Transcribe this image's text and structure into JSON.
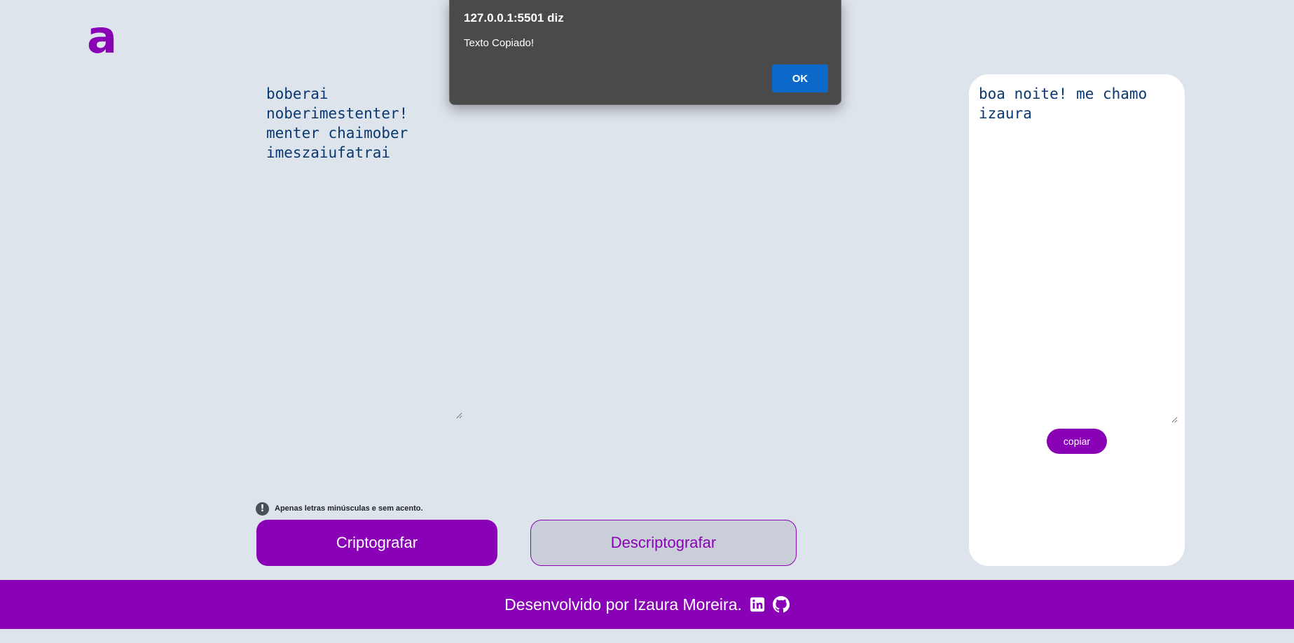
{
  "logo": {
    "text": "a"
  },
  "input": {
    "text": "boberai\nnoberimestenter!\nmenter chaimober\nimeszaiufatrai"
  },
  "hint": {
    "icon": "!",
    "text": "Apenas letras minúsculas e sem acento."
  },
  "buttons": {
    "encrypt": "Criptografar",
    "decrypt": "Descriptografar"
  },
  "output": {
    "text": "boa noite! me chamo\nizaura",
    "copy_label": "copiar"
  },
  "footer": {
    "text": "Desenvolvido por Izaura Moreira.",
    "icons": [
      "linkedin-icon",
      "github-icon"
    ]
  },
  "alert": {
    "title": "127.0.0.1:5501 diz",
    "message": "Texto Copiado!",
    "ok": "OK"
  },
  "colors": {
    "accent": "#8a02b6",
    "background": "#dee4ec",
    "text": "#0a3871",
    "alert_bg": "#4a4a4a",
    "alert_button": "#0b6ac9"
  }
}
